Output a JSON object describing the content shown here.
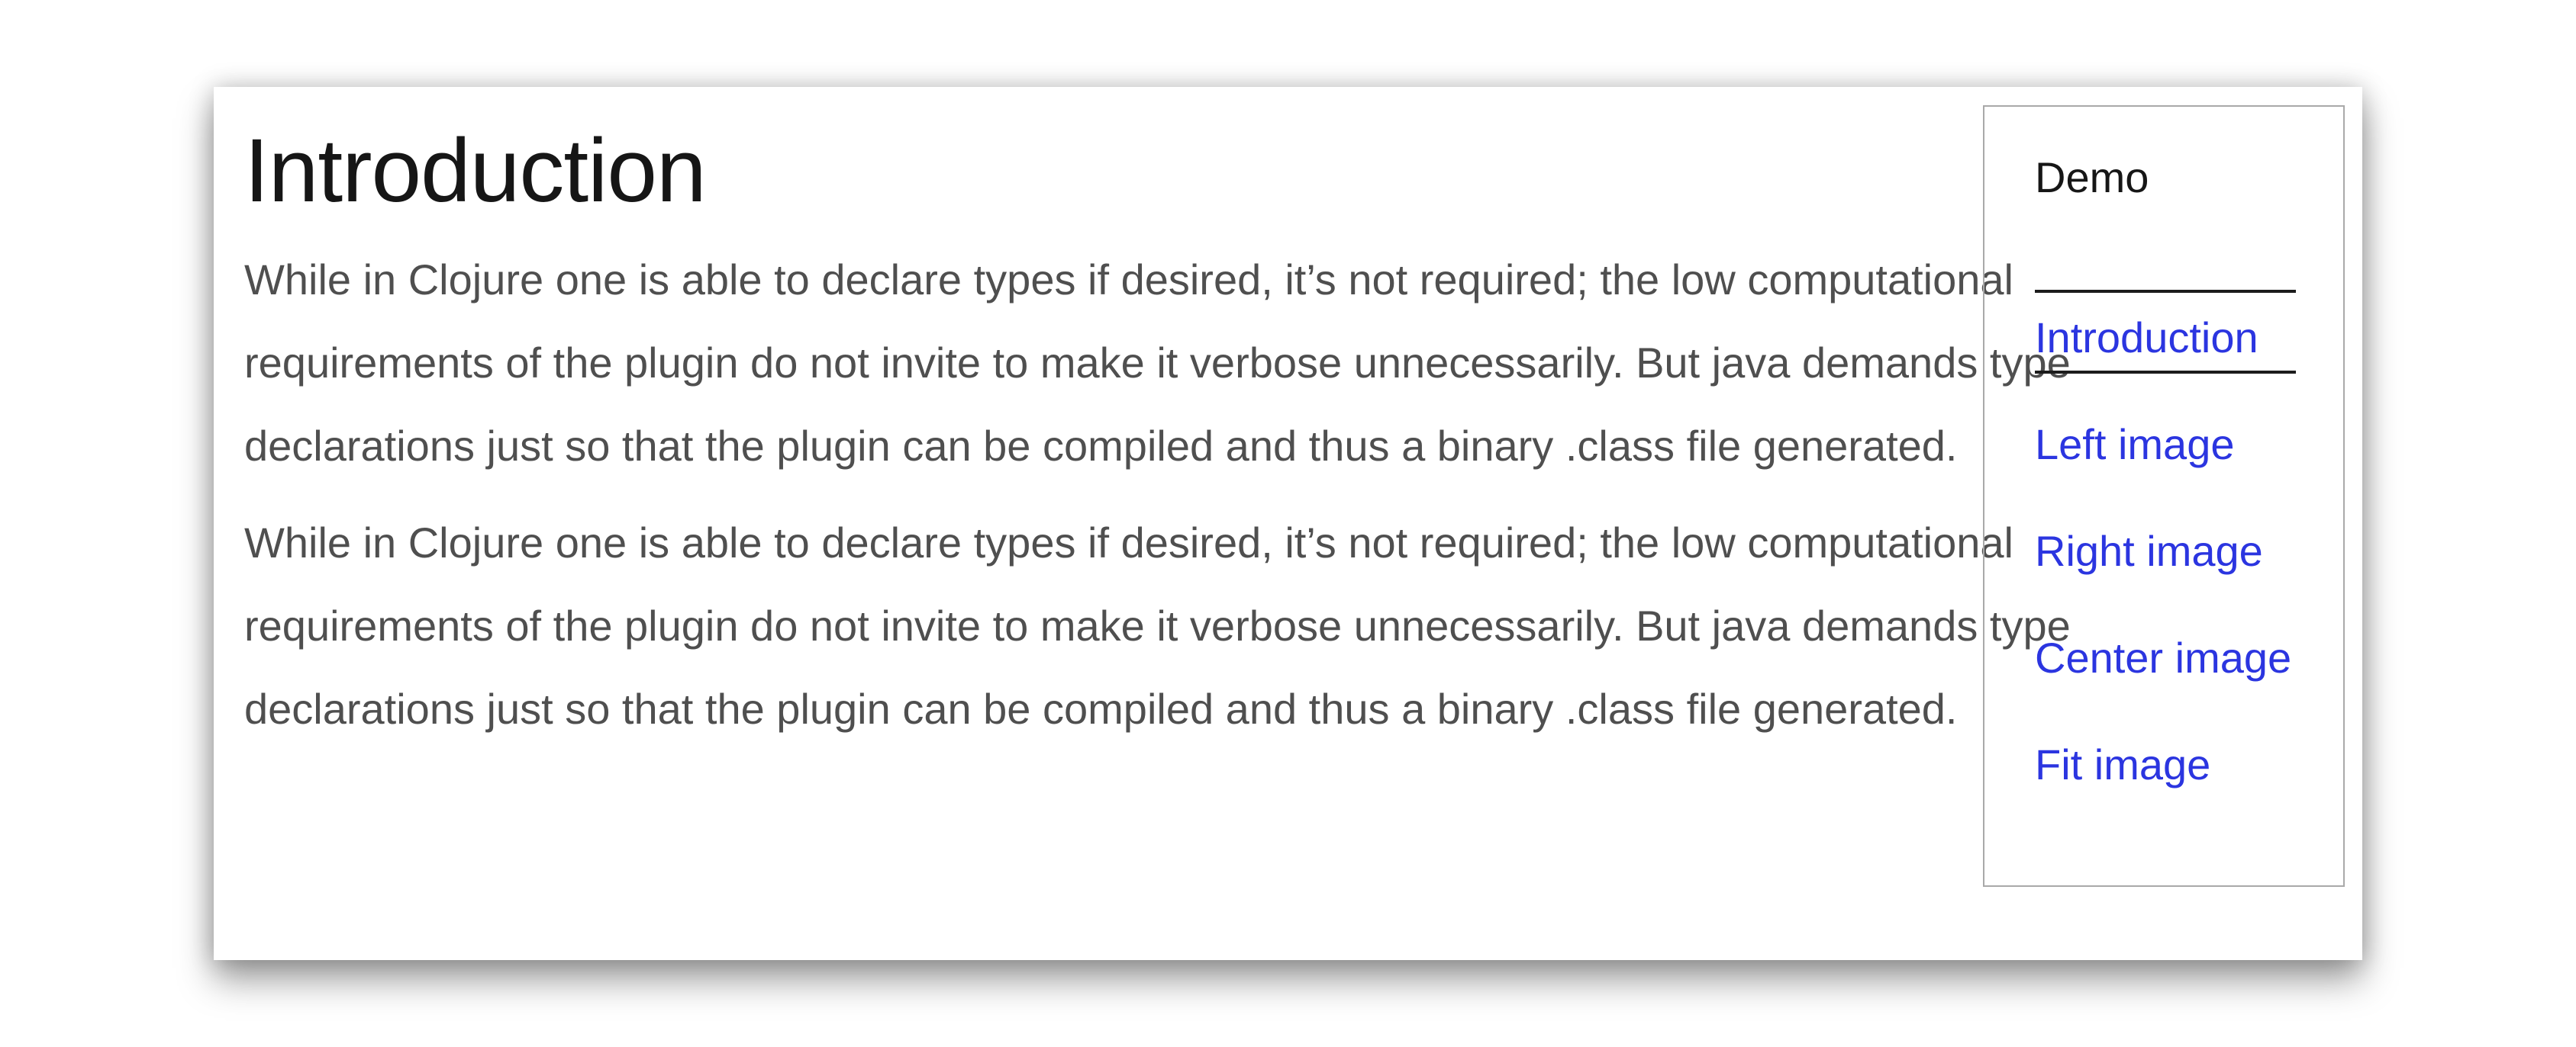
{
  "main": {
    "title": "Introduction",
    "paragraphs": [
      "While in Clojure one is able to declare types if desired, it’s not required; the low computational requirements of the plugin do not invite to make it verbose unnecessarily. But java demands type declarations just so that the plugin can be compiled and thus a binary .class file generated.",
      "While in Clojure one is able to declare types if desired, it’s not required; the low computational requirements of the plugin do not invite to make it verbose unnecessarily. But java demands type declarations just so that the plugin can be compiled and thus a binary .class file generated."
    ]
  },
  "toc": {
    "title": "Demo",
    "items": [
      {
        "label": "Introduction",
        "active": true
      },
      {
        "label": "Left image",
        "active": false
      },
      {
        "label": "Right image",
        "active": false
      },
      {
        "label": "Center image",
        "active": false
      },
      {
        "label": "Fit image",
        "active": false
      }
    ]
  },
  "colors": {
    "link": "#2b35e0",
    "body_text": "#4f4f4f",
    "heading": "#161616",
    "border": "#a9a9a9"
  }
}
